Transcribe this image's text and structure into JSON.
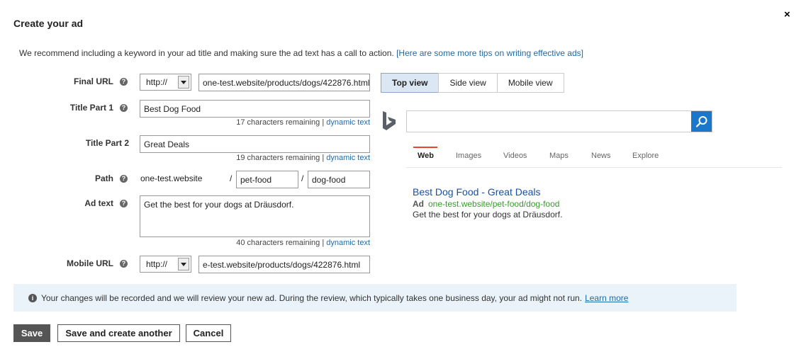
{
  "dialog": {
    "title": "Create your ad",
    "close_glyph": "×",
    "intro_text": "We recommend including a keyword in your ad title and making sure the ad text has a call to action.",
    "intro_link": "[Here are some more tips on writing effective ads]"
  },
  "form": {
    "final_url": {
      "label": "Final URL",
      "protocol": "http://",
      "value": "one-test.website/products/dogs/422876.html"
    },
    "title_part1": {
      "label": "Title Part 1",
      "value": "Best Dog Food",
      "remaining": "17 characters remaining",
      "separator": " | ",
      "dynamic": "dynamic text"
    },
    "title_part2": {
      "label": "Title Part 2",
      "value": "Great Deals",
      "remaining": "19 characters remaining",
      "separator": " | ",
      "dynamic": "dynamic text"
    },
    "path": {
      "label": "Path",
      "domain": "one-test.website",
      "slash": "/",
      "path1": "pet-food",
      "path2": "dog-food"
    },
    "ad_text": {
      "label": "Ad text",
      "value": "Get the best for your dogs at Dräusdorf.",
      "remaining": "40 characters remaining",
      "separator": " | ",
      "dynamic": "dynamic text"
    },
    "mobile_url": {
      "label": "Mobile URL",
      "protocol": "http://",
      "value": "e-test.website/products/dogs/422876.html"
    },
    "help_glyph": "?"
  },
  "preview": {
    "tabs": [
      "Top view",
      "Side view",
      "Mobile view"
    ],
    "active_tab": 0,
    "search_tabs": [
      "Web",
      "Images",
      "Videos",
      "Maps",
      "News",
      "Explore"
    ],
    "ad": {
      "title": "Best Dog Food - Great Deals",
      "ad_label": "Ad",
      "display_url": "one-test.website/pet-food/dog-food",
      "description": "Get the best for your dogs at Dräusdorf."
    }
  },
  "notice": {
    "info_glyph": "i",
    "text": "Your changes will be recorded and we will review your new ad. During the review, which typically takes one business day, your ad might not run.",
    "link": "Learn more"
  },
  "buttons": {
    "save": "Save",
    "save_and_create": "Save and create another",
    "cancel": "Cancel"
  },
  "colors": {
    "accent_blue": "#1a77c9",
    "bing_red": "#e8462b",
    "ad_url_green": "#3a9a2e",
    "notice_bg": "#e9f3f9"
  }
}
